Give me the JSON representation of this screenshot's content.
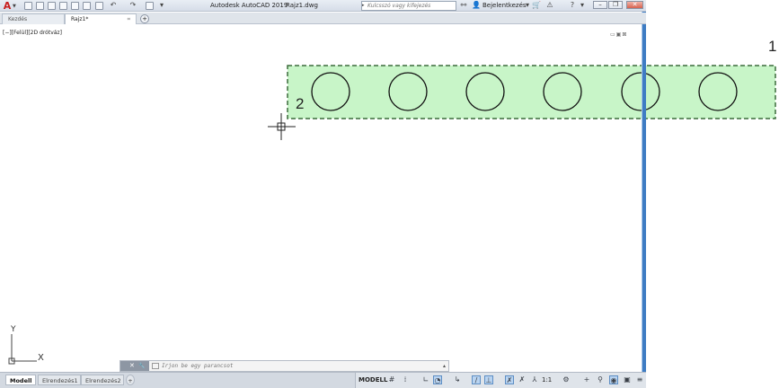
{
  "app": {
    "logo": "A",
    "title": "Autodesk AutoCAD 2019",
    "file": "Rajz1.dwg"
  },
  "search": {
    "placeholder": "Kulcsszó vagy kifejezés"
  },
  "account": {
    "signin_label": "Bejelentkezés"
  },
  "file_tabs": [
    {
      "label": "Kezdés"
    },
    {
      "label": "Rajz1*"
    }
  ],
  "viewport": {
    "label": "[−][Felül][2D drótváz]"
  },
  "drawing": {
    "callout_1": "1",
    "callout_2": "2",
    "selection_window": {
      "style": "crossing",
      "fill": "#c8f5c8",
      "border": "#3b6b3b"
    },
    "circle_count": 6
  },
  "ucs": {
    "x_label": "X",
    "y_label": "Y"
  },
  "command_line": {
    "placeholder": "Írjon be egy parancsot",
    "close_glyph": "✕",
    "settings_glyph": "🔧"
  },
  "layout_tabs": [
    {
      "label": "Modell"
    },
    {
      "label": "Elrendezés1"
    },
    {
      "label": "Elrendezés2"
    }
  ],
  "status_bar": {
    "space_label": "MODELL",
    "scale": "1:1"
  },
  "colors": {
    "accent_blue": "#3e7cc3",
    "logo_red": "#c81d1d"
  }
}
